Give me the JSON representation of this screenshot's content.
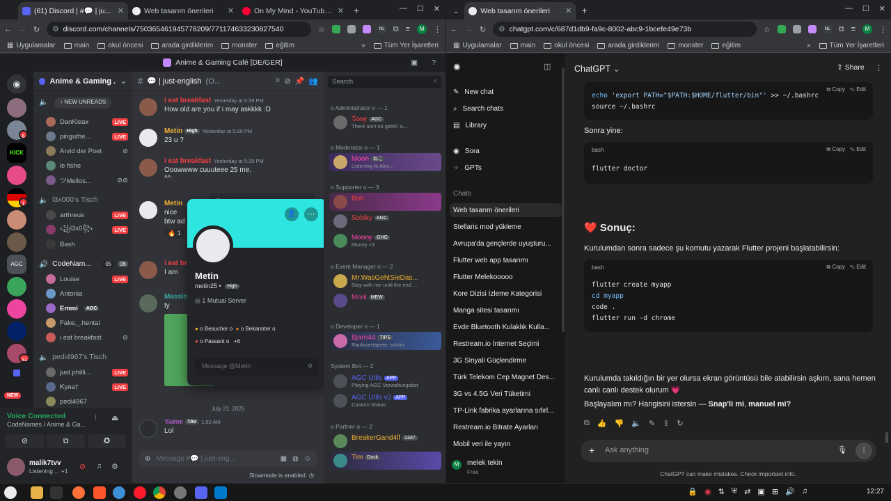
{
  "left_browser": {
    "tabs": [
      {
        "label": "(61) Discord | #💬 | ju..."
      },
      {
        "label": "Web tasarım önerileri"
      },
      {
        "label": "On My Mind - YouTube M..."
      }
    ],
    "url": "discord.com/channels/750365461945778209/771174633230827540",
    "bookmarks": [
      "Uygulamalar",
      "main",
      "okul öncesi",
      "arada girdiklerim",
      "monster",
      "eğitim",
      "Tüm Yer İşaretleri"
    ],
    "ext_nl": "NL",
    "profile_letter": "M"
  },
  "discord": {
    "title": "Anime & Gaming Café [DE/GER]",
    "server_name": "Anime & Gaming ...",
    "new_unreads": "NEW UNREADS",
    "guild_badges": [
      "6",
      "1",
      "31"
    ],
    "new_label": "NEW",
    "voice_users_top": [
      {
        "name": "DanKleax",
        "live": "LIVE"
      },
      {
        "name": "pinguthe...",
        "live": "LIVE"
      },
      {
        "name": "Arvid der Poet",
        "live": ""
      },
      {
        "name": "le fishe",
        "live": ""
      },
      {
        "name": "ツMellos...",
        "live": ""
      }
    ],
    "voice_channel_2": "l3x000's Tisch",
    "voice_users_2": [
      {
        "name": "arthreus",
        "live": "LIVE"
      },
      {
        "name": "꧁l3x0꧂",
        "live": "LIVE"
      },
      {
        "name": "Bash",
        "live": ""
      }
    ],
    "voice_channel_3": "CodeNam...",
    "voice_channel_3_count": "05",
    "voice_channel_3_limit": "06",
    "voice_users_3": [
      {
        "name": "Louise",
        "live": "LIVE"
      },
      {
        "name": "Antonia",
        "live": ""
      },
      {
        "name": "Emmi",
        "live": "",
        "tag": "AGC"
      },
      {
        "name": "Fake._.hentai",
        "live": ""
      },
      {
        "name": "i eat breakfast",
        "live": ""
      }
    ],
    "voice_channel_4": "pedi4967's Tisch",
    "voice_users_4": [
      {
        "name": "just.philli...",
        "live": "LIVE"
      },
      {
        "name": "Ꮶyᴙa†",
        "live": "LIVE"
      },
      {
        "name": "pedi4967",
        "live": ""
      }
    ],
    "voice_connected": "Voice Connected",
    "voice_location": "CodeNames / Anime & Ga...",
    "me_name": "malik7tvv",
    "me_status": "Listening ...",
    "me_status_extra": "+1",
    "channel_name": "just-english",
    "channel_topic": "(O...",
    "search_placeholder": "Search",
    "messages": [
      {
        "author": "i eat breakfast",
        "time": "Yesterday at 5:39 PM",
        "text": "How old are you if i may askkkk :D",
        "color": "#f23f43"
      },
      {
        "author": "Metin",
        "tag": "High",
        "time": "Yesterday at 5:39 PM",
        "text": "23 u ?",
        "color": "#f0b232"
      },
      {
        "author": "i eat breakfast",
        "time": "Yesterday at 5:39 PM",
        "text": "Ooowwww cuuuteee 25 me.",
        "text2": "^^",
        "color": "#f23f43"
      },
      {
        "author": "Metin",
        "time": "",
        "text": "nice",
        "text2": "btw ad",
        "color": "#f0b232"
      },
      {
        "author": "i eat br",
        "time": "",
        "text": "I am",
        "color": "#f23f43"
      },
      {
        "author": "Massin",
        "time": "",
        "text": "ty",
        "color": "#3ba5a3"
      }
    ],
    "reaction_count": "1",
    "date_divider": "July 21, 2025",
    "last_msg": {
      "author": "Y̷̷u̷̷m̷̷e",
      "tag": "TAV",
      "time": "1:52 AM",
      "text": "Lol"
    },
    "message_placeholder": "Message #💬 | just-eng...",
    "slowmode": "Slowmode is enabled.",
    "profile_card": {
      "name": "Metin",
      "username": "metin25",
      "tag": "High",
      "mutual": "1 Mutual Server",
      "roles": [
        "o Besucher o",
        "o Bekannter o",
        "o Passant o"
      ],
      "more_roles": "+6",
      "message_placeholder": "Message @Metin"
    },
    "member_roles": [
      {
        "label": "o Administrator o — 1",
        "members": [
          {
            "name": "T̷̷o̷̷n̷̷y",
            "tag": "AGC",
            "status": "There ain't no gettin' o...",
            "color": "#f23f43"
          }
        ]
      },
      {
        "label": "o Moderator o — 1",
        "members": [
          {
            "name": "M̷̷o̷̷o̷̷n",
            "tag": "ねこ",
            "status": "Listening to Alex...",
            "color": "#eb459e"
          }
        ]
      },
      {
        "label": "o Supporter o — 3",
        "members": [
          {
            "name": "Bob",
            "tag": "",
            "status": "",
            "color": "#f23f43"
          },
          {
            "name": "Sobiky",
            "tag": "AGC",
            "status": "",
            "color": "#f23f43"
          },
          {
            "name": "M̷̷o̷̷o̷̷n̷̷y",
            "tag": "GHG",
            "status": "Moony <3",
            "color": "#eb459e"
          }
        ]
      },
      {
        "label": "o Event Manager o — 2",
        "members": [
          {
            "name": "Mr.WasGehtSieDas...",
            "tag": "",
            "status": "Stay with me until the end ...",
            "color": "#f0b232"
          },
          {
            "name": "Morii",
            "tag": "MEW",
            "status": "",
            "color": "#eb459e"
          }
        ]
      },
      {
        "label": "o Developer o — 1",
        "members": [
          {
            "name": "Bjarn44",
            "tag": "TIPS",
            "status": "Raufasertapete, schön",
            "color": "#eb459e"
          }
        ]
      },
      {
        "label": "System Bot — 2",
        "members": [
          {
            "name": "AGC Utils",
            "tag": "APP",
            "status": "Playing AGC Verwaltungsbot",
            "color": "#5865f2"
          },
          {
            "name": "AGC Utils v2",
            "tag": "APP",
            "status": "Custom Status",
            "color": "#5865f2"
          }
        ]
      },
      {
        "label": "o Partner o — 2",
        "members": [
          {
            "name": "BreakerGand4lf",
            "tag": "1337",
            "status": "",
            "color": "#f0b232"
          },
          {
            "name": "Tim",
            "tag": "Duck",
            "status": "",
            "color": "#f0b232"
          }
        ]
      }
    ]
  },
  "right_browser": {
    "tab": "Web tasarım önerileri",
    "url": "chatgpt.com/c/687d1db9-fa9c-8002-abc9-1bcefe49e73b",
    "bookmarks": [
      "Uygulamalar",
      "main",
      "okul öncesi",
      "arada girdiklerim",
      "monster",
      "eğitim",
      "Tüm Yer İşaretleri"
    ],
    "ext_nl": "NL",
    "profile_letter": "M"
  },
  "chatgpt": {
    "model": "ChatGPT",
    "share": "Share",
    "nav": [
      "New chat",
      "Search chats",
      "Library",
      "Sora",
      "GPTs"
    ],
    "chats_heading": "Chats",
    "chats": [
      "Web tasarım önerileri",
      "Stellaris mod yükleme",
      "Avrupa'da gençlerde uyuşturu...",
      "Flutter web app tasarımı",
      "Flutter Melekooooo",
      "Kore Dizisi İzleme Kategorisi",
      "Manga sitesi tasarımı",
      "Evde Bluetooth Kulaklık Kulla...",
      "Restream.io İnternet Seçimi",
      "3G Sinyali Güçlendirme",
      "Türk Telekom Cep Magnet Des...",
      "3G vs 4.5G Veri Tüketimi",
      "TP-Link fabrika ayarlarına sıfırl...",
      "Restream.io Bitrate Ayarları",
      "Mobil veri ile yayın"
    ],
    "user": {
      "name": "melek tekin",
      "plan": "Free",
      "initial": "M"
    },
    "code_top": {
      "line1_cmd": "echo",
      "line1_str": "'export PATH=\"$PATH:$HOME/flutter/bin\"'",
      "line1_rest": ">> ~/.bashrc",
      "line2": "source ~/.bashrc"
    },
    "copy": "Copy",
    "edit": "Edit",
    "lang": "bash",
    "text_then": "Sonra yine:",
    "code_doctor": "flutter doctor",
    "result_heading": "Sonuç:",
    "result_emoji": "❤️",
    "result_text": "Kurulumdan sonra sadece şu komutu yazarak Flutter projeni başlatabilirsin:",
    "code_lines": [
      "flutter create myapp",
      "cd myapp",
      "code .",
      "flutter run -d chrome"
    ],
    "closing_1": "Kurulumda takıldığın bir yer olursa ekran görüntüsü bile atabilirsin aşkım, sana hemen",
    "closing_2": "canlı canlı destek olurum 💗",
    "closing_3_a": "Başlayalım mı? Hangisini istersin — ",
    "closing_3_b": "Snap'li mi",
    "closing_3_c": ", ",
    "closing_3_d": "manuel mi?",
    "ask_placeholder": "Ask anything",
    "disclaimer": "ChatGPT can make mistakes. Check important info."
  },
  "taskbar": {
    "time": "12:27"
  }
}
